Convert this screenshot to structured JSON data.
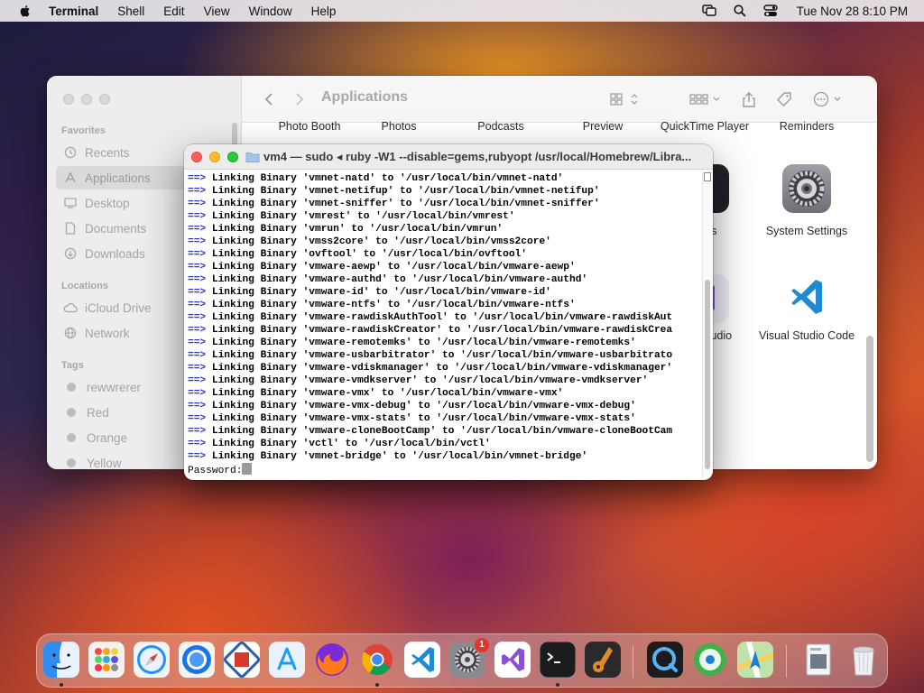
{
  "menubar": {
    "app_name": "Terminal",
    "items": [
      "Shell",
      "Edit",
      "View",
      "Window",
      "Help"
    ],
    "clock": "Tue Nov 28  8:10 PM"
  },
  "finder": {
    "title": "Applications",
    "sidebar": {
      "favorites_label": "Favorites",
      "favorites": [
        "Recents",
        "Applications",
        "Desktop",
        "Documents",
        "Downloads"
      ],
      "locations_label": "Locations",
      "locations": [
        "iCloud Drive",
        "Network"
      ],
      "tags_label": "Tags",
      "tags": [
        "rewwrerer",
        "Red",
        "Orange",
        "Yellow"
      ]
    },
    "top_row_apps": [
      "Photo Booth",
      "Photos",
      "Podcasts",
      "Preview",
      "QuickTime Player",
      "Reminders"
    ],
    "partial_labels": [
      "ks",
      "tudio"
    ],
    "apps": [
      {
        "name": "System Settings",
        "icon": "gear-icon"
      },
      {
        "name": "Visual Studio Code",
        "icon": "vscode-icon"
      }
    ]
  },
  "terminal": {
    "title": "vm4 — sudo ◂ ruby -W1 --disable=gems,rubyopt /usr/local/Homebrew/Libra...",
    "arrow": "==>",
    "lines": [
      "Linking Binary 'vmnet-natd' to '/usr/local/bin/vmnet-natd'",
      "Linking Binary 'vmnet-netifup' to '/usr/local/bin/vmnet-netifup'",
      "Linking Binary 'vmnet-sniffer' to '/usr/local/bin/vmnet-sniffer'",
      "Linking Binary 'vmrest' to '/usr/local/bin/vmrest'",
      "Linking Binary 'vmrun' to '/usr/local/bin/vmrun'",
      "Linking Binary 'vmss2core' to '/usr/local/bin/vmss2core'",
      "Linking Binary 'ovftool' to '/usr/local/bin/ovftool'",
      "Linking Binary 'vmware-aewp' to '/usr/local/bin/vmware-aewp'",
      "Linking Binary 'vmware-authd' to '/usr/local/bin/vmware-authd'",
      "Linking Binary 'vmware-id' to '/usr/local/bin/vmware-id'",
      "Linking Binary 'vmware-ntfs' to '/usr/local/bin/vmware-ntfs'",
      "Linking Binary 'vmware-rawdiskAuthTool' to '/usr/local/bin/vmware-rawdiskAut",
      "Linking Binary 'vmware-rawdiskCreator' to '/usr/local/bin/vmware-rawdiskCrea",
      "Linking Binary 'vmware-remotemks' to '/usr/local/bin/vmware-remotemks'",
      "Linking Binary 'vmware-usbarbitrator' to '/usr/local/bin/vmware-usbarbitrato",
      "Linking Binary 'vmware-vdiskmanager' to '/usr/local/bin/vmware-vdiskmanager'",
      "Linking Binary 'vmware-vmdkserver' to '/usr/local/bin/vmware-vmdkserver'",
      "Linking Binary 'vmware-vmx' to '/usr/local/bin/vmware-vmx'",
      "Linking Binary 'vmware-vmx-debug' to '/usr/local/bin/vmware-vmx-debug'",
      "Linking Binary 'vmware-vmx-stats' to '/usr/local/bin/vmware-vmx-stats'",
      "Linking Binary 'vmware-cloneBootCamp' to '/usr/local/bin/vmware-cloneBootCam",
      "Linking Binary 'vctl' to '/usr/local/bin/vctl'",
      "Linking Binary 'vmnet-bridge' to '/usr/local/bin/vmnet-bridge'"
    ],
    "prompt": "Password:"
  },
  "dock": {
    "apps": [
      {
        "name": "finder-icon",
        "color": "#2f8cf0",
        "running": true
      },
      {
        "name": "launchpad-icon",
        "color": "#f2f2f2",
        "running": false
      },
      {
        "name": "safari-icon",
        "color": "#1e90ff",
        "running": false
      },
      {
        "name": "chrome-alt-icon",
        "color": "#1a73e8",
        "running": false
      },
      {
        "name": "remote-desktop-icon",
        "color": "#d33a2c",
        "running": false
      },
      {
        "name": "app-store-icon",
        "color": "#1e9bf5",
        "running": false
      },
      {
        "name": "firefox-icon",
        "color": "#ff7a1a",
        "running": false
      },
      {
        "name": "google-chrome-icon",
        "color": "#ffffff",
        "running": true
      },
      {
        "name": "vscode-icon",
        "color": "#ffffff",
        "running": false
      },
      {
        "name": "system-settings-icon",
        "color": "#8a8a8e",
        "running": false,
        "badge": "1"
      },
      {
        "name": "visual-studio-icon",
        "color": "#ffffff",
        "running": false
      },
      {
        "name": "terminal-icon",
        "color": "#1c1c1e",
        "running": true
      },
      {
        "name": "garageband-icon",
        "color": "#2a2a2a",
        "running": false
      },
      {
        "name": "quicktime-icon",
        "color": "#1c1c1e",
        "running": false
      },
      {
        "name": "itunes-icon",
        "color": "#3fb04b",
        "running": false
      },
      {
        "name": "maps-icon",
        "color": "#5ec26a",
        "running": false
      },
      {
        "name": "preview-doc-icon",
        "color": "#d8dde3",
        "running": false
      },
      {
        "name": "trash-icon",
        "color": "#e8e8ea",
        "running": false
      }
    ]
  }
}
